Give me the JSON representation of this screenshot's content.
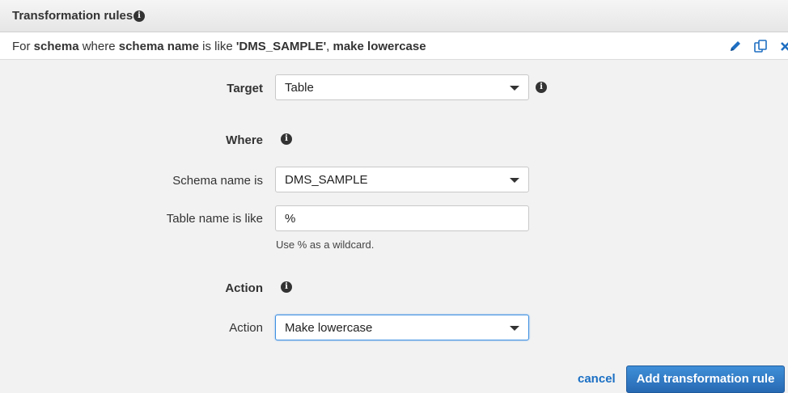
{
  "header": {
    "title": "Transformation rules",
    "info_icon": "info-icon"
  },
  "rule_summary": {
    "prefix": "For ",
    "object": "schema",
    "mid1": " where ",
    "field": "schema name",
    "mid2": " is like ",
    "pattern": "'DMS_SAMPLE'",
    "mid3": ", ",
    "action": "make lowercase",
    "icons": [
      "pencil-icon",
      "copy-icon",
      "close-icon"
    ]
  },
  "form": {
    "target": {
      "label": "Target",
      "value": "Table"
    },
    "where": {
      "heading": "Where",
      "schema_label": "Schema name is",
      "schema_value": "DMS_SAMPLE",
      "table_label": "Table name is like",
      "table_value": "%",
      "table_hint": "Use % as a wildcard."
    },
    "action": {
      "heading": "Action",
      "label": "Action",
      "value": "Make lowercase"
    }
  },
  "buttons": {
    "cancel": "cancel",
    "add": "Add transformation rule"
  },
  "colors": {
    "accent": "#1a6fc4",
    "primary_button": "#2f7bc8",
    "focus_border": "#3d8fe0"
  }
}
